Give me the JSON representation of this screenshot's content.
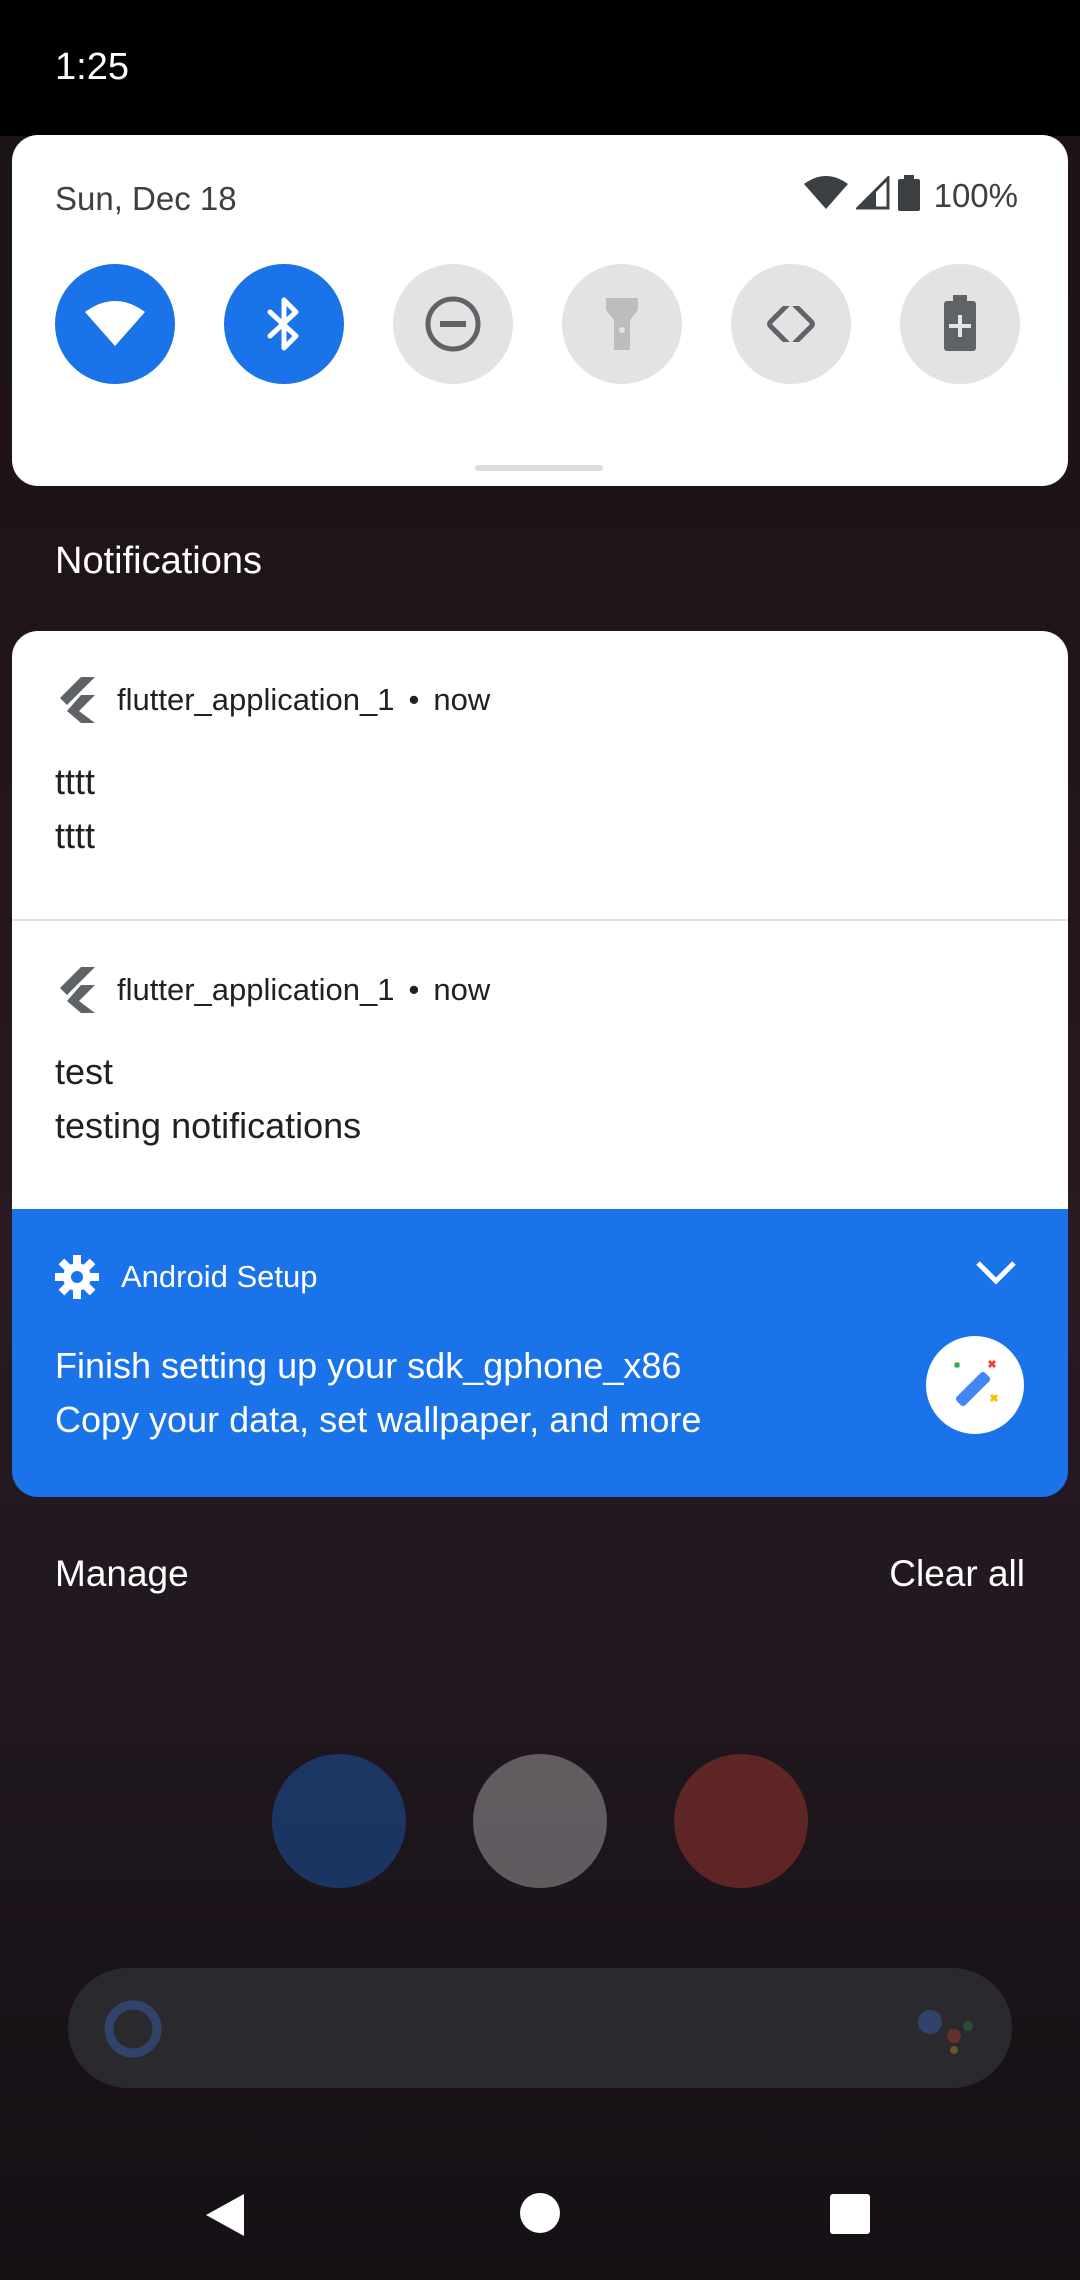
{
  "status_bar": {
    "time": "1:25"
  },
  "quick_settings": {
    "date": "Sun, Dec 18",
    "battery_percent": "100%",
    "tiles": [
      {
        "name": "wifi",
        "state": "on"
      },
      {
        "name": "bluetooth",
        "state": "on"
      },
      {
        "name": "do-not-disturb",
        "state": "off"
      },
      {
        "name": "flashlight",
        "state": "off"
      },
      {
        "name": "auto-rotate",
        "state": "off"
      },
      {
        "name": "battery-saver",
        "state": "off"
      }
    ]
  },
  "notifications_header": "Notifications",
  "notifications": [
    {
      "app": "flutter_application_1",
      "separator": "•",
      "time": "now",
      "title": "tttt",
      "body": "tttt"
    },
    {
      "app": "flutter_application_1",
      "separator": "•",
      "time": "now",
      "title": "test",
      "body": "testing notifications"
    }
  ],
  "setup_notification": {
    "app": "Android Setup",
    "title": "Finish setting up your sdk_gphone_x86",
    "body": "Copy your data, set wallpaper, and more"
  },
  "footer": {
    "manage": "Manage",
    "clear_all": "Clear all"
  },
  "colors": {
    "accent": "#1a73e8",
    "tile_off": "#e3e3e3",
    "panel": "#ffffff"
  }
}
